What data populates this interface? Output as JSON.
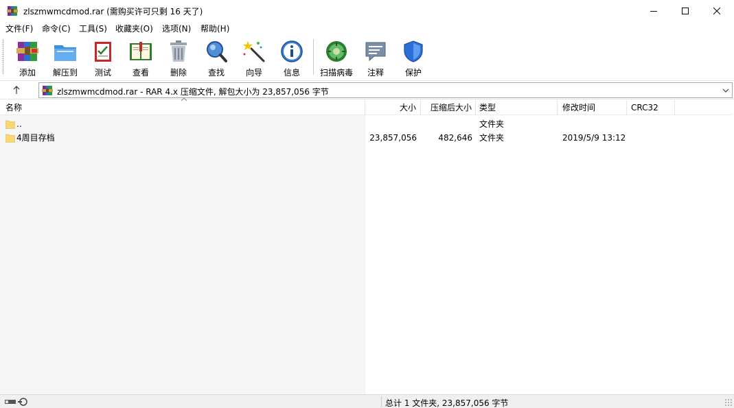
{
  "window": {
    "title": "zlszmwmcdmod.rar (需购买许可只剩 16 天了)",
    "controls": {
      "minimize": "minimize",
      "maximize": "maximize",
      "close": "close"
    }
  },
  "menu": [
    {
      "label": "文件(F)"
    },
    {
      "label": "命令(C)"
    },
    {
      "label": "工具(S)"
    },
    {
      "label": "收藏夹(O)"
    },
    {
      "label": "选项(N)"
    },
    {
      "label": "帮助(H)"
    }
  ],
  "toolbar": [
    {
      "label": "添加",
      "icon": "add-archive-icon"
    },
    {
      "label": "解压到",
      "icon": "extract-to-icon"
    },
    {
      "label": "测试",
      "icon": "test-icon"
    },
    {
      "label": "查看",
      "icon": "view-book-icon"
    },
    {
      "label": "删除",
      "icon": "trash-icon"
    },
    {
      "label": "查找",
      "icon": "magnifier-icon"
    },
    {
      "label": "向导",
      "icon": "wizard-wand-icon"
    },
    {
      "label": "信息",
      "icon": "info-icon"
    },
    {
      "label": "扫描病毒",
      "icon": "virus-scan-icon"
    },
    {
      "label": "注释",
      "icon": "comment-icon"
    },
    {
      "label": "保护",
      "icon": "shield-icon"
    }
  ],
  "address": {
    "text": "zlszmwmcdmod.rar - RAR 4.x 压缩文件, 解包大小为 23,857,056 字节"
  },
  "columns": {
    "name": "名称",
    "size": "大小",
    "packed": "压缩后大小",
    "type": "类型",
    "modified": "修改时间",
    "crc": "CRC32"
  },
  "rows": [
    {
      "name": "..",
      "size": "",
      "packed": "",
      "type": "文件夹",
      "modified": "",
      "crc": ""
    },
    {
      "name": "4周目存档",
      "size": "23,857,056",
      "packed": "482,646",
      "type": "文件夹",
      "modified": "2019/5/9 13:12",
      "crc": ""
    }
  ],
  "status": {
    "text": "总计 1 文件夹, 23,857,056 字节"
  },
  "colors": {
    "folder": "#f8d775",
    "accent": "#0a64c8"
  }
}
